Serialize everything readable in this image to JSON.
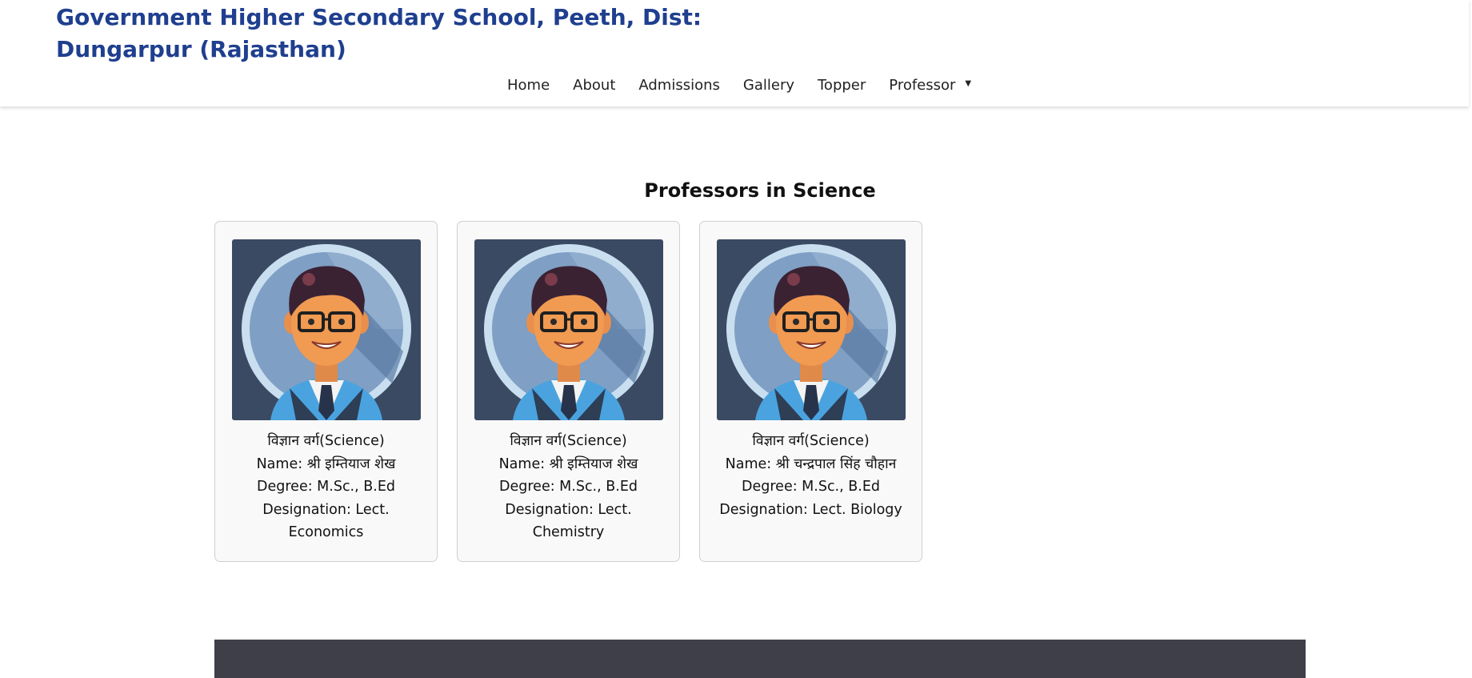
{
  "site": {
    "title": "Government Higher Secondary School, Peeth, Dist: Dungarpur (Rajasthan)"
  },
  "nav": {
    "items": [
      "Home",
      "About",
      "Admissions",
      "Gallery",
      "Topper",
      "Professor"
    ],
    "dropdown_icon": "caret-down-icon"
  },
  "section": {
    "title": "Professors in Science"
  },
  "professors": [
    {
      "category": "विज्ञान वर्ग(Science)",
      "name": "Name: श्री इम्तियाज शेख",
      "degree": "Degree: M.Sc., B.Ed",
      "designation": "Designation: Lect. Economics",
      "avatar_icon": "professor-avatar-icon"
    },
    {
      "category": "विज्ञान वर्ग(Science)",
      "name": "Name: श्री इम्तियाज शेख",
      "degree": "Degree: M.Sc., B.Ed",
      "designation": "Designation: Lect. Chemistry",
      "avatar_icon": "professor-avatar-icon"
    },
    {
      "category": "विज्ञान वर्ग(Science)",
      "name": "Name: श्री चन्द्रपाल सिंह चौहान",
      "degree": "Degree: M.Sc., B.Ed",
      "designation": "Designation: Lect. Biology",
      "avatar_icon": "professor-avatar-icon"
    }
  ],
  "colors": {
    "title_blue": "#1f3f8f",
    "footer_dark": "#3e3f48",
    "avatar_bg": "#3b4a63"
  }
}
